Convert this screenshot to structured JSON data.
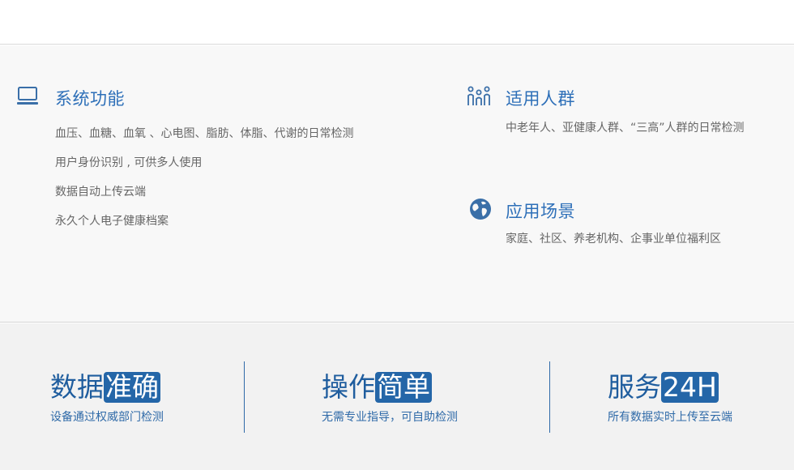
{
  "features": {
    "system": {
      "title": "系统功能",
      "icon": "laptop-icon",
      "lines": [
        "血压、血糖、血氧 、心电图、脂肪、体脂、代谢的日常检测",
        "用户身份识别 , 可供多人使用",
        "数据自动上传云端",
        "永久个人电子健康档案"
      ]
    },
    "audience": {
      "title": "适用人群",
      "icon": "people-group-icon",
      "text": "中老年人、亚健康人群、“三高”人群的日常检测"
    },
    "scenarios": {
      "title": "应用场景",
      "icon": "globe-icon",
      "text": "家庭、社区、养老机构、企事业单位福利区"
    }
  },
  "stats": [
    {
      "prefix": "数据",
      "highlight": "准确",
      "subtitle": "设备通过权威部门检测"
    },
    {
      "prefix": "操作",
      "highlight": "简单",
      "subtitle": "无需专业指导，可自助检测"
    },
    {
      "prefix": "服务",
      "highlight": "24H",
      "subtitle": "所有数据实时上传至云端"
    }
  ],
  "colors": {
    "accent": "#2d6fb8",
    "highlight_bg": "#2466a8",
    "body_text": "#666666"
  }
}
